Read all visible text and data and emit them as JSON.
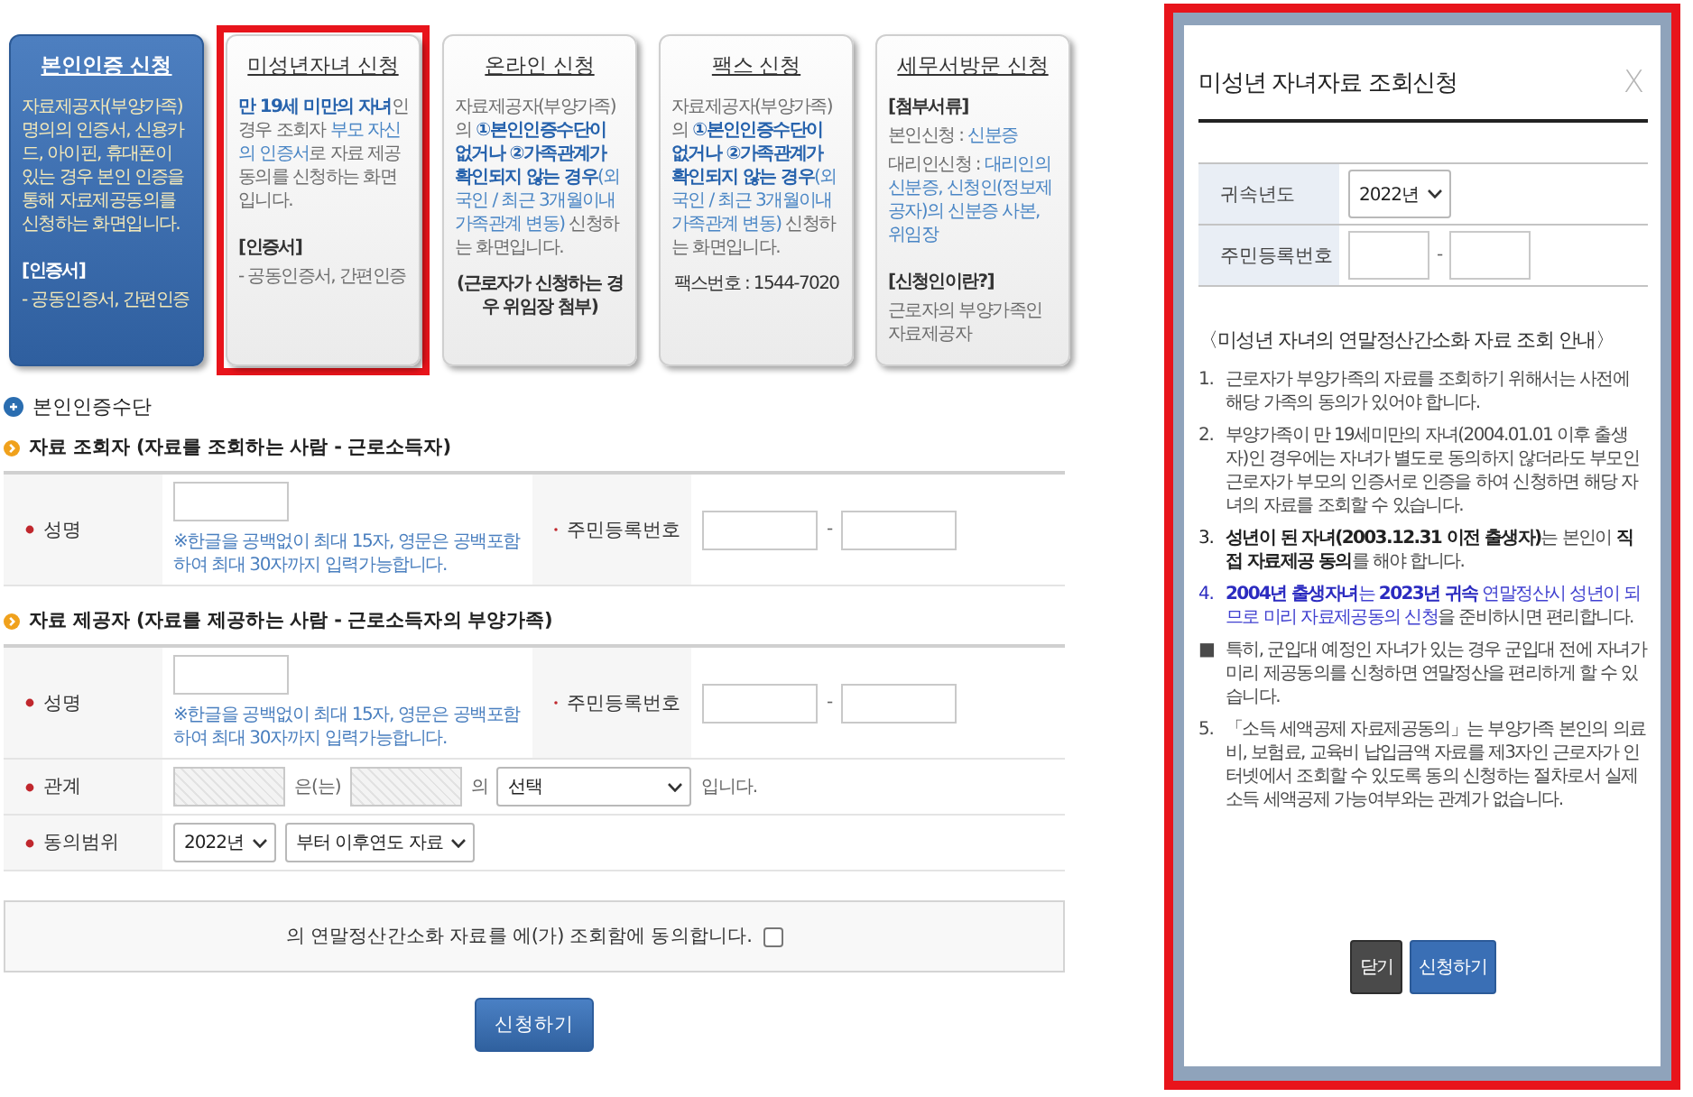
{
  "cards": [
    {
      "title": "본인인증 신청",
      "selected": true,
      "highlighted": false,
      "paragraphs": [
        {
          "kind": "text",
          "segments": [
            {
              "text": "자료제공자(부양가족) 명의의 인증서, 신용카드, 아이핀, 휴대폰이 있는 경우 본인 인증을 통해 자료제공동의를 신청하는 화면입니다.",
              "kind": "plain"
            }
          ]
        },
        {
          "kind": "label",
          "segments": [
            {
              "text": "[인증서]",
              "kind": "strong"
            }
          ]
        },
        {
          "kind": "text",
          "segments": [
            {
              "text": "- 공동인증서, 간편인증",
              "kind": "plain"
            }
          ]
        }
      ]
    },
    {
      "title": "미성년자녀 신청",
      "selected": false,
      "highlighted": true,
      "paragraphs": [
        {
          "kind": "text",
          "segments": [
            {
              "text": "만 19세 미만의 자녀",
              "kind": "emphasis"
            },
            {
              "text": "인 경우 조회자 ",
              "kind": "plain"
            },
            {
              "text": "부모 자신의 인증서",
              "kind": "link"
            },
            {
              "text": "로 자료 제공 동의를 신청하는 화면입니다.",
              "kind": "plain"
            }
          ]
        },
        {
          "kind": "label",
          "segments": [
            {
              "text": "[인증서]",
              "kind": "strong"
            }
          ]
        },
        {
          "kind": "text",
          "segments": [
            {
              "text": "- 공동인증서, 간편인증",
              "kind": "plain"
            }
          ]
        }
      ]
    },
    {
      "title": "온라인 신청",
      "selected": false,
      "highlighted": false,
      "paragraphs": [
        {
          "kind": "text",
          "segments": [
            {
              "text": "자료제공자(부양가족)의 ",
              "kind": "plain"
            },
            {
              "text": "①본인인증수단이 없거나 ②가족관계가 확인되지 않는 경우",
              "kind": "emphasis"
            },
            {
              "text": "(외국인 / 최근 3개월이내 가족관계 변동)",
              "kind": "link"
            },
            {
              "text": " 신청하는 화면입니다.",
              "kind": "plain"
            }
          ]
        },
        {
          "kind": "centered",
          "segments": [
            {
              "text": "(근로자가 신청하는 경우 위임장 첨부)",
              "kind": "strong"
            }
          ]
        }
      ]
    },
    {
      "title": "팩스 신청",
      "selected": false,
      "highlighted": false,
      "paragraphs": [
        {
          "kind": "text",
          "segments": [
            {
              "text": "자료제공자(부양가족)의 ",
              "kind": "plain"
            },
            {
              "text": "①본인인증수단이 없거나 ②가족관계가 확인되지 않는 경우",
              "kind": "emphasis"
            },
            {
              "text": "(외국인 / 최근 3개월이내 가족관계 변동)",
              "kind": "link"
            },
            {
              "text": " 신청하는 화면입니다.",
              "kind": "plain"
            }
          ]
        },
        {
          "kind": "centered",
          "segments": [
            {
              "text": "팩스번호 : 1544-7020",
              "kind": "dark"
            }
          ]
        }
      ]
    },
    {
      "title": "세무서방문 신청",
      "selected": false,
      "highlighted": false,
      "paragraphs": [
        {
          "kind": "label",
          "segments": [
            {
              "text": "[첨부서류]",
              "kind": "strong"
            }
          ]
        },
        {
          "kind": "text",
          "segments": [
            {
              "text": "본인신청 : ",
              "kind": "plain"
            },
            {
              "text": "신분증",
              "kind": "link"
            }
          ]
        },
        {
          "kind": "text",
          "segments": [
            {
              "text": "대리인신청 : ",
              "kind": "plain"
            },
            {
              "text": "대리인의 신분증, 신청인(정보제공자)의 신분증 사본, 위임장",
              "kind": "link"
            }
          ]
        },
        {
          "kind": "label",
          "segments": [
            {
              "text": "[신청인이란?]",
              "kind": "strong"
            }
          ]
        },
        {
          "kind": "text",
          "segments": [
            {
              "text": "근로자의 부양가족인 자료제공자",
              "kind": "plain"
            }
          ]
        }
      ]
    }
  ],
  "form": {
    "section_title": "본인인증수단",
    "groups": [
      {
        "title": "자료 조회자 (자료를 조회하는 사람 - 근로소득자)",
        "rows": [
          {
            "fields": [
              {
                "label": "성명",
                "required": true,
                "controls": [
                  {
                    "kind": "input",
                    "disabled": false
                  }
                ],
                "note": "※한글을 공백없이 최대 15자, 영문은 공백포함하여 최대 30자까지 입력가능합니다."
              },
              {
                "label": "주민등록번호",
                "required": true,
                "controls": [
                  {
                    "kind": "input",
                    "disabled": false
                  },
                  {
                    "kind": "text",
                    "text": "-"
                  },
                  {
                    "kind": "input",
                    "disabled": false
                  }
                ]
              }
            ]
          }
        ]
      },
      {
        "title": "자료 제공자 (자료를 제공하는 사람 - 근로소득자의 부양가족)",
        "rows": [
          {
            "fields": [
              {
                "label": "성명",
                "required": true,
                "controls": [
                  {
                    "kind": "input",
                    "disabled": false
                  }
                ],
                "note": "※한글을 공백없이 최대 15자, 영문은 공백포함하여 최대 30자까지 입력가능합니다."
              },
              {
                "label": "주민등록번호",
                "required": true,
                "controls": [
                  {
                    "kind": "input",
                    "disabled": false
                  },
                  {
                    "kind": "text",
                    "text": "-"
                  },
                  {
                    "kind": "input",
                    "disabled": false
                  }
                ]
              }
            ]
          },
          {
            "fields": [
              {
                "label": "관계",
                "required": true,
                "controls": [
                  {
                    "kind": "input",
                    "disabled": true
                  },
                  {
                    "kind": "text",
                    "text": "은(는)"
                  },
                  {
                    "kind": "input",
                    "disabled": true
                  },
                  {
                    "kind": "text",
                    "text": "의"
                  },
                  {
                    "kind": "select",
                    "value": "선택"
                  },
                  {
                    "kind": "text",
                    "text": "입니다."
                  }
                ]
              }
            ]
          },
          {
            "fields": [
              {
                "label": "동의범위",
                "required": true,
                "controls": [
                  {
                    "kind": "select",
                    "value": "2022년"
                  },
                  {
                    "kind": "select",
                    "value": "부터 이후연도 자료"
                  }
                ]
              }
            ]
          }
        ]
      }
    ]
  },
  "consent": {
    "text": "의 연말정산간소화 자료를 에(가) 조회함에 동의합니다.",
    "checked": false
  },
  "submit": {
    "label": "신청하기"
  },
  "dialog": {
    "title": "미성년 자녀자료 조회신청",
    "close": "X",
    "highlighted": true,
    "fields": [
      {
        "label": "귀속년도",
        "controls": [
          {
            "kind": "select",
            "value": "2022년"
          }
        ]
      },
      {
        "label": "주민등록번호",
        "controls": [
          {
            "kind": "input",
            "disabled": false
          },
          {
            "kind": "text",
            "text": "-"
          },
          {
            "kind": "input",
            "disabled": false
          }
        ]
      }
    ],
    "notice_title": "〈미성년 자녀의 연말정산간소화 자료 조회 안내〉",
    "notices": [
      {
        "marker": "1.",
        "segments": [
          {
            "text": "근로자가 부양가족의 자료를 조회하기 위해서는 사전에 해당 가족의 동의가 있어야 합니다.",
            "kind": "plain"
          }
        ]
      },
      {
        "marker": "2.",
        "segments": [
          {
            "text": "부양가족이 만 19세미만의 자녀(2004.01.01 이후 출생자)인 경우에는 자녀가 별도로 동의하지 않더라도 부모인 근로자가 부모의 인증서로 인증을 하여 신청하면 해당 자녀의 자료를 조회할 수 있습니다.",
            "kind": "plain"
          }
        ]
      },
      {
        "marker": "3.",
        "segments": [
          {
            "text": "성년이 된 자녀(2003.12.31 이전 출생자)",
            "kind": "strong"
          },
          {
            "text": "는 본인이 ",
            "kind": "plain"
          },
          {
            "text": "직접 자료제공 동의",
            "kind": "strong"
          },
          {
            "text": "를 해야 합니다.",
            "kind": "plain"
          }
        ]
      },
      {
        "marker": "4.",
        "segments": [
          {
            "text": "2004년 출생자녀",
            "kind": "emphasis"
          },
          {
            "text": "는 ",
            "kind": "link"
          },
          {
            "text": "2023년 귀속",
            "kind": "emphasis"
          },
          {
            "text": " 연말정산시 성년이 되므로 미리 자료제공동의 신청",
            "kind": "link"
          },
          {
            "text": "을 준비하시면 편리합니다.",
            "kind": "plain"
          }
        ]
      },
      {
        "marker": "■",
        "segments": [
          {
            "text": "특히, 군입대 예정인 자녀가 있는 경우 군입대 전에 자녀가 미리 제공동의를 신청하면 연말정산을 편리하게 할 수 있습니다.",
            "kind": "plain"
          }
        ]
      },
      {
        "marker": "5.",
        "segments": [
          {
            "text": "「소득 세액공제 자료제공동의」는 부양가족 본인의 의료비, 보험료, 교육비 납입금액 자료를 제3자인 근로자가 인터넷에서 조회할 수 있도록 동의 신청하는 절차로서 실제 소득 세액공제 가능여부와는 관계가 없습니다.",
            "kind": "plain"
          }
        ]
      }
    ],
    "buttons": [
      {
        "label": "닫기",
        "kind": "secondary"
      },
      {
        "label": "신청하기",
        "kind": "primary"
      }
    ]
  }
}
